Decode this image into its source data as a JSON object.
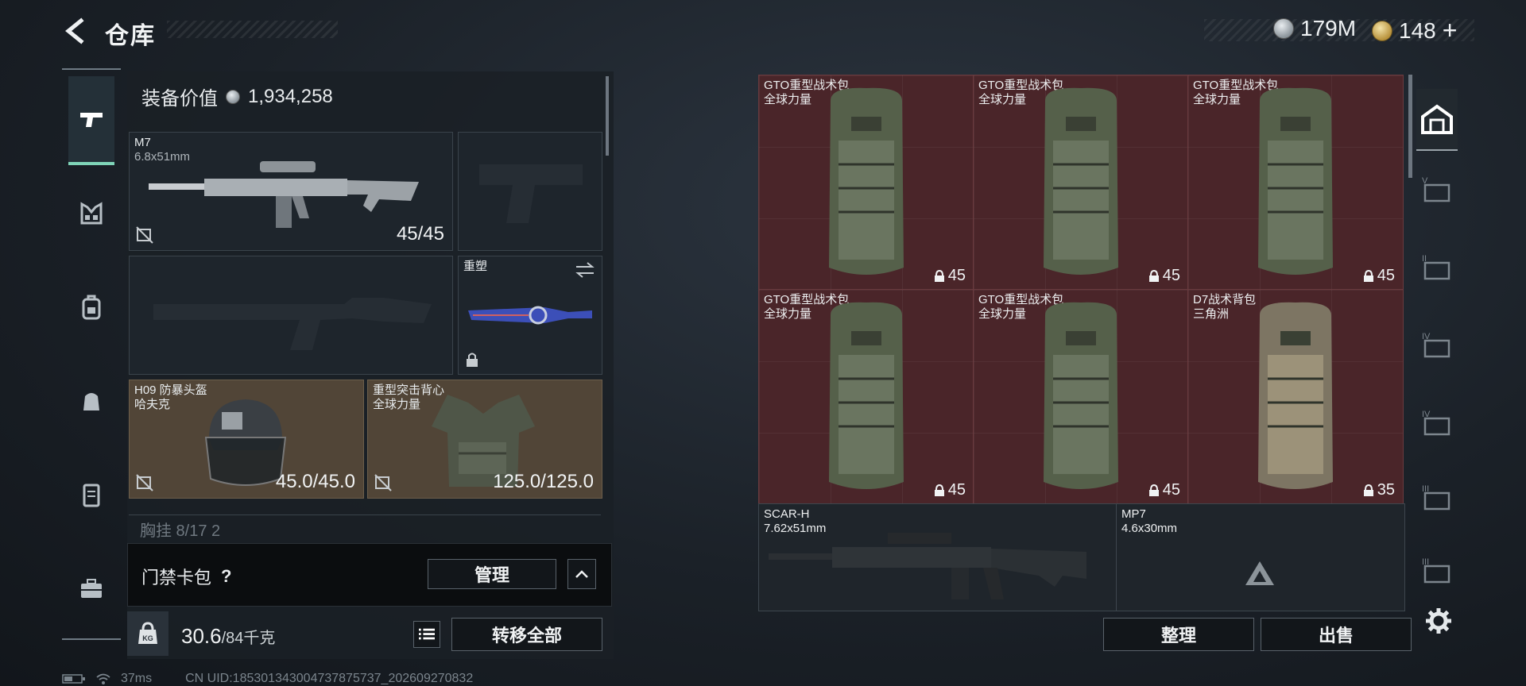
{
  "header": {
    "title": "仓库",
    "currency_silver": "179M",
    "currency_gold": "148",
    "plus": "+"
  },
  "sidebar": {
    "tabs": [
      "pistol-icon",
      "vest-icon",
      "backpack-icon",
      "bag-icon",
      "locker-icon",
      "toolbox-icon"
    ]
  },
  "loadout": {
    "value_label": "装备价值",
    "value": "1,934,258",
    "primary": {
      "name": "M7",
      "caliber": "6.8x51mm",
      "ammo": "45/45"
    },
    "melee": {
      "name": "重塑"
    },
    "helmet": {
      "name": "H09 防暴头盔",
      "brand": "哈夫克",
      "durability": "45.0/45.0"
    },
    "armor": {
      "name": "重型突击背心",
      "brand": "全球力量",
      "durability": "125.0/125.0"
    },
    "chest": {
      "label": "胸挂 8/17 2"
    }
  },
  "access": {
    "label": "门禁卡包",
    "help": "?",
    "manage": "管理"
  },
  "weight": {
    "current": "30.6",
    "max": "/84千克",
    "transfer": "转移全部"
  },
  "status": {
    "ping": "37ms",
    "uid": "CN UID:185301343004737875737_202609270832"
  },
  "stash": {
    "items": [
      {
        "name": "GTO重型战术包",
        "brand": "全球力量",
        "count": "45"
      },
      {
        "name": "GTO重型战术包",
        "brand": "全球力量",
        "count": "45"
      },
      {
        "name": "GTO重型战术包",
        "brand": "全球力量",
        "count": "45"
      },
      {
        "name": "GTO重型战术包",
        "brand": "全球力量",
        "count": "45"
      },
      {
        "name": "GTO重型战术包",
        "brand": "全球力量",
        "count": "45"
      },
      {
        "name": "D7战术背包",
        "brand": "三角洲",
        "count": "35"
      }
    ],
    "guns": [
      {
        "name": "SCAR-H",
        "caliber": "7.62x51mm"
      },
      {
        "name": "MP7",
        "caliber": "4.6x30mm"
      }
    ],
    "sort": "整理",
    "sell": "出售"
  },
  "colors": {
    "accent": "#7fd4b8",
    "item_red": "#4a2529",
    "item_brown": "#514537"
  }
}
